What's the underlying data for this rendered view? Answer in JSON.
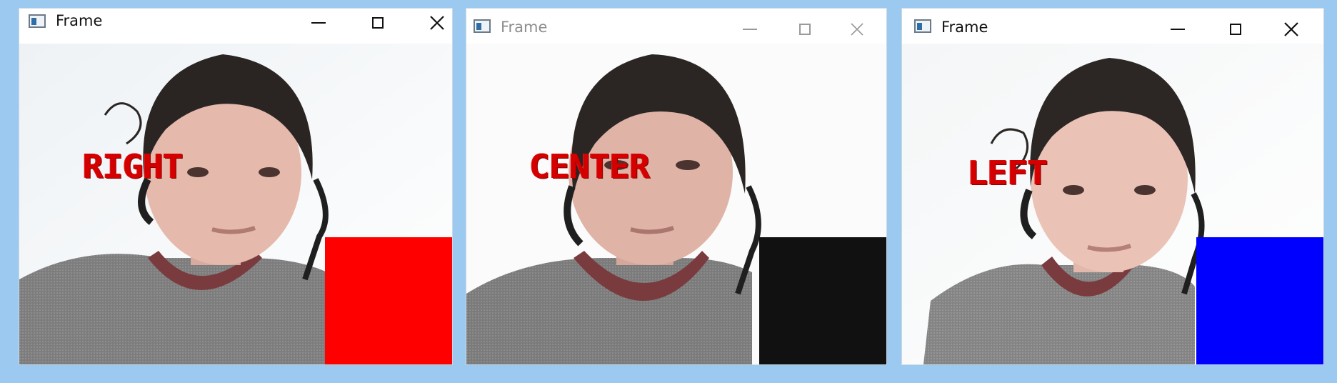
{
  "windows": [
    {
      "title": "Frame",
      "icon": "app-window-icon",
      "controls": [
        "minimize-icon",
        "maximize-icon",
        "close-icon"
      ],
      "direction_label": "RIGHT",
      "label_color": "#d40000",
      "indicator_color": "#ff0000"
    },
    {
      "title": "Frame",
      "icon": "app-window-icon",
      "controls": [
        "minimize-icon",
        "maximize-icon",
        "close-icon"
      ],
      "direction_label": "CENTER",
      "label_color": "#d40000",
      "indicator_color": "#111111"
    },
    {
      "title": "Frame",
      "icon": "app-window-icon",
      "controls": [
        "minimize-icon",
        "maximize-icon",
        "close-icon"
      ],
      "direction_label": "LEFT",
      "label_color": "#d40000",
      "indicator_color": "#0000ff"
    }
  ],
  "background_color": "#9cc9f0"
}
